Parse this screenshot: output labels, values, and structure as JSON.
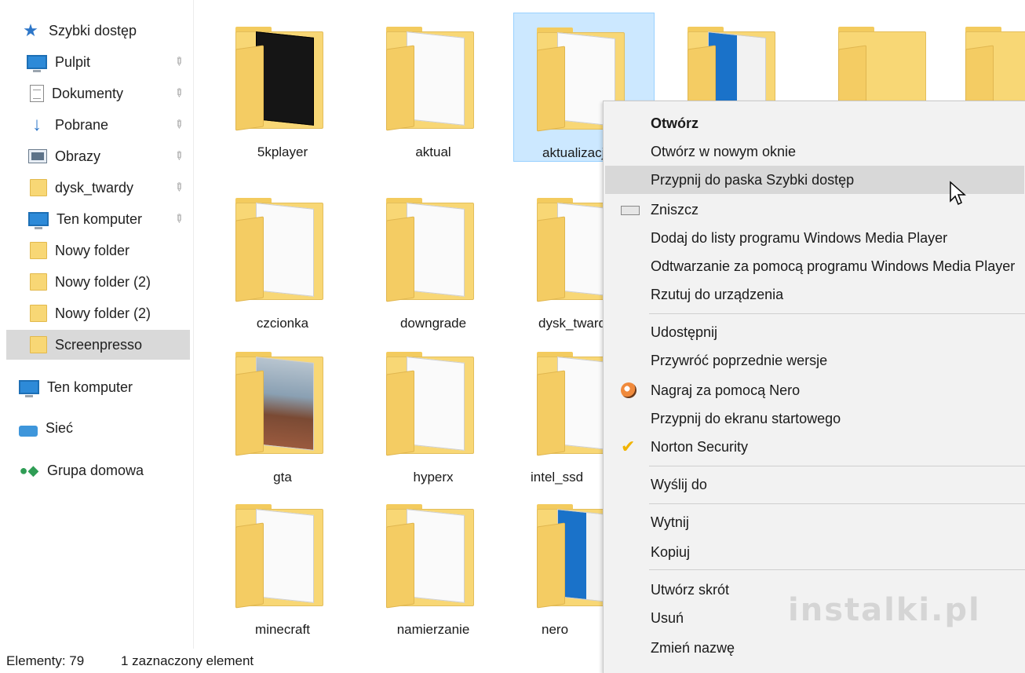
{
  "sidebar": {
    "quick_access": "Szybki dostęp",
    "items": [
      {
        "label": "Pulpit",
        "icon": "desktop-icon",
        "pinned": true
      },
      {
        "label": "Dokumenty",
        "icon": "documents-icon",
        "pinned": true
      },
      {
        "label": "Pobrane",
        "icon": "download-icon",
        "pinned": true
      },
      {
        "label": "Obrazy",
        "icon": "pictures-icon",
        "pinned": true
      },
      {
        "label": "dysk_twardy",
        "icon": "folder-icon",
        "pinned": true
      },
      {
        "label": "Ten komputer",
        "icon": "computer-icon",
        "pinned": true
      },
      {
        "label": "Nowy folder",
        "icon": "folder-icon",
        "pinned": false
      },
      {
        "label": "Nowy folder (2)",
        "icon": "folder-icon",
        "pinned": false
      },
      {
        "label": "Nowy folder (2)",
        "icon": "folder-icon",
        "pinned": false
      },
      {
        "label": "Screenpresso",
        "icon": "folder-icon",
        "pinned": false,
        "selected": true
      }
    ],
    "this_pc": "Ten komputer",
    "network": "Sieć",
    "homegroup": "Grupa domowa"
  },
  "folders": [
    {
      "name": "5kplayer"
    },
    {
      "name": "aktual"
    },
    {
      "name": "aktualizacje",
      "selected": true
    },
    {
      "name": ""
    },
    {
      "name": ""
    },
    {
      "name": ""
    },
    {
      "name": "czcionka"
    },
    {
      "name": "downgrade"
    },
    {
      "name": "dysk_twardy"
    },
    {
      "name": "gta"
    },
    {
      "name": "hyperx"
    },
    {
      "name": "intel_ssd"
    },
    {
      "name": "minecraft"
    },
    {
      "name": "namierzanie"
    },
    {
      "name": "nero"
    }
  ],
  "context_menu": {
    "items": [
      "Otwórz",
      "Otwórz w nowym oknie",
      "Przypnij do paska Szybki dostęp",
      "Zniszcz",
      "Dodaj do listy programu Windows Media Player",
      "Odtwarzanie za pomocą programu Windows Media Player",
      "Rzutuj do urządzenia",
      "Udostępnij",
      "Przywróć poprzednie wersje",
      "Nagraj za pomocą Nero",
      "Przypnij do ekranu startowego",
      "Norton Security",
      "Wyślij do",
      "Wytnij",
      "Kopiuj",
      "Utwórz skrót",
      "Usuń",
      "Zmień nazwę"
    ],
    "hovered": "Przypnij do paska Szybki dostęp"
  },
  "watermark": "instalki.pl",
  "status_bar": {
    "items_count": "Elementy: 79",
    "selected": "1 zaznaczony element"
  },
  "colors": {
    "selection": "#cce8ff",
    "selection_border": "#99d1ff",
    "folder": "#f8d775",
    "menu_bg": "#f2f2f2",
    "menu_hover": "#d8d8d8",
    "nav_selected": "#d9d9d9"
  }
}
